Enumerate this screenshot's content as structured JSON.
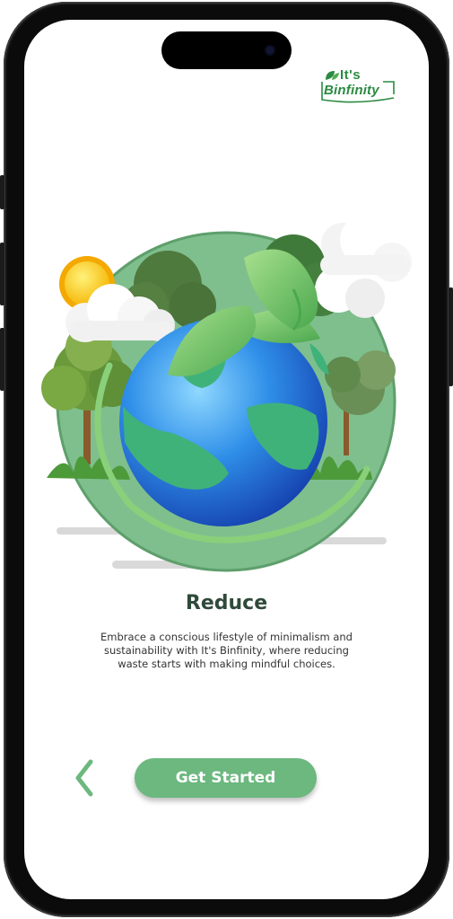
{
  "brand": {
    "logo_top": "It's",
    "logo_bottom": "Binfinity"
  },
  "onboarding": {
    "title": "Reduce",
    "description": "Embrace a conscious lifestyle of minimalism and sustainability with It's Binfinity, where reducing waste starts with making mindful choices."
  },
  "actions": {
    "back_icon": "chevron-left-icon",
    "get_started_label": "Get Started"
  },
  "colors": {
    "accent": "#6cb87f",
    "title": "#2f4a3a",
    "logo": "#2b8a42",
    "circle": "#7fbf8e"
  }
}
